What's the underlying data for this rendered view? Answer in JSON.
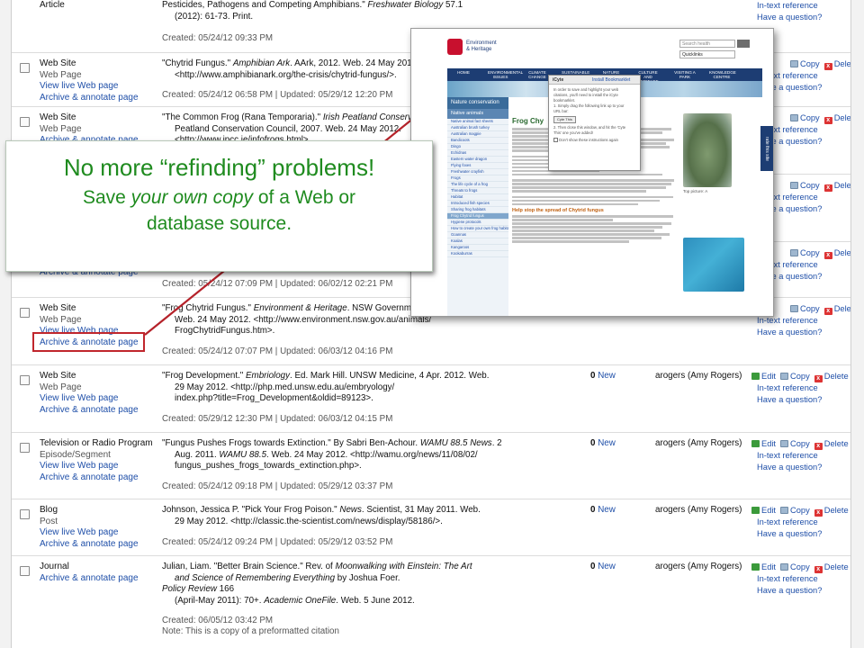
{
  "actions": {
    "edit": "Edit",
    "copy": "Copy",
    "delete": "Delete",
    "intext": "In-text reference",
    "question": "Have a question?"
  },
  "row0": {
    "type": "Article",
    "cite1": "Pesticides, Pathogens and Competing Amphibians.\" ",
    "cite1_it": "Freshwater Biology",
    "cite1_end": " 57.1",
    "cite2": "(2012): 61-73. Print.",
    "created": "Created: 05/24/12 09:33 PM"
  },
  "row1": {
    "type": "Web Site",
    "sub": "Web Page",
    "link1": "View live Web page",
    "link2": "Archive & annotate page",
    "cite1a": "\"Chytrid Fungus.\" ",
    "cite1_it": "Amphibian Ark",
    "cite1b": ". AArk, 2012. Web. 24 May 2012",
    "cite2": "<http://www.amphibianark.org/the-crisis/chytrid-fungus/>.",
    "created": "Created: 05/24/12 06:58 PM | Updated: 05/29/12 12:20 PM"
  },
  "row2": {
    "type": "Web Site",
    "sub": "Web Page",
    "link2": "Archive & annotate page",
    "cite1a": "\"The Common Frog (Rana Temporaria).\" ",
    "cite1_it": "Irish Peatland Conserv",
    "cite2": "Peatland Conservation Council, 2007. Web. 24 May 2012.",
    "cite3": "<http://www.ipcc.ie/infofrogs.html>."
  },
  "row3": {
    "link2": "Archive & annotate page",
    "created": "Created: 05/24/12 07:09 PM | Updated: 06/02/12 02:21 PM"
  },
  "row4": {
    "type": "Web Site",
    "sub": "Web Page",
    "link1": "View live Web page",
    "link2": "Archive & annotate page",
    "cite1a": "\"Frog Chytrid Fungus.\" ",
    "cite1_it": "Environment & Heritage",
    "cite1b": ". NSW Governme",
    "cite2": "Web. 24 May 2012. <http://www.environment.nsw.gov.au/animals/",
    "cite3": "FrogChytridFungus.htm>.",
    "created": "Created: 05/24/12 07:07 PM | Updated: 06/03/12 04:16 PM"
  },
  "row5": {
    "type": "Web Site",
    "sub": "Web Page",
    "link1": "View live Web page",
    "link2": "Archive & annotate page",
    "cite1a": "\"Frog Development.\" ",
    "cite1_it": "Embriology",
    "cite1b": ". Ed. Mark Hill. UNSW Medicine, 4 Apr. 2012. Web.",
    "cite2": "29 May 2012. <http://php.med.unsw.edu.au/embryology/",
    "cite3": "index.php?title=Frog_Development&oldid=89123>.",
    "created": "Created: 05/29/12 12:30 PM | Updated: 06/03/12 04:15 PM",
    "count": "0",
    "new": "New",
    "owner": "arogers (Amy Rogers)"
  },
  "row6": {
    "type": "Television or Radio Program",
    "sub": "Episode/Segment",
    "link1": "View live Web page",
    "link2": "Archive & annotate page",
    "cite1a": "\"Fungus Pushes Frogs towards Extinction.\" By Sabri Ben-Achour. ",
    "cite1_it": "WAMU 88.5 News",
    "cite1b": ". 2",
    "cite2a": "Aug. 2011. ",
    "cite2_it": "WAMU 88.5",
    "cite2b": ". Web. 24 May 2012. <http://wamu.org/news/11/08/02/",
    "cite3": "fungus_pushes_frogs_towards_extinction.php>.",
    "created": "Created: 05/24/12 09:18 PM | Updated: 05/29/12 03:37 PM",
    "count": "0",
    "new": "New",
    "owner": "arogers (Amy Rogers)"
  },
  "row7": {
    "type": "Blog",
    "sub": "Post",
    "link1": "View live Web page",
    "link2": "Archive & annotate page",
    "cite1a": "Johnson, Jessica P. \"Pick Your Frog Poison.\" ",
    "cite1_it": "News",
    "cite1b": ". Scientist, 31 May 2011. Web.",
    "cite2": "29 May 2012. <http://classic.the-scientist.com/news/display/58186/>.",
    "created": "Created: 05/24/12 09:24 PM | Updated: 05/29/12 03:52 PM",
    "count": "0",
    "new": "New",
    "owner": "arogers (Amy Rogers)"
  },
  "row8": {
    "type": "Journal",
    "link2": "Archive & annotate page",
    "cite1a": "Julian, Liam. \"Better Brain Science.\" Rev. of ",
    "cite1_it": "Moonwalking with Einstein: The Art",
    "cite2_it": "and Science of Remembering Everything",
    "cite2b": " by Joshua Foer.",
    "cite3_it": "Policy Review",
    "cite3b": " 166",
    "cite4a": "(April-May 2011): 70+. ",
    "cite4_it": "Academic OneFile",
    "cite4b": ". Web. 5 June 2012.",
    "created": "Created: 06/05/12 03:42 PM",
    "note": "Note: This is a copy of a preformatted citation",
    "count": "0",
    "new": "New",
    "owner": "arogers (Amy Rogers)"
  },
  "callout": {
    "line1": "No more “refinding” problems!",
    "line2a": "Save ",
    "line2_it": "your own copy",
    "line2b": " of a Web or",
    "line3": "database source."
  },
  "shot": {
    "org1": "Environment",
    "org2": "& Heritage",
    "search_placeholder": "Search health",
    "quicklinks": "Quicklinks",
    "nav": [
      "HOME",
      "ENVIRONMENTAL ISSUES",
      "CLIMATE CHANGE",
      "SUSTAINABLE LIVING",
      "NATURE",
      "CULTURE AND HERITAGE",
      "VISITING A PARK",
      "KNOWLEDGE CENTRE"
    ],
    "side_title": "Nature conservation",
    "side_sub": "Native animals",
    "side_items": [
      "Native animal fact sheets",
      "Australian brush turkey",
      "Australian magpie",
      "Bandicoots",
      "Dingo",
      "Echidnas",
      "Eastern water dragon",
      "Flying foxes",
      "Freshwater crayfish",
      "Frogs",
      "The life cycle of a frog",
      "Threats to frogs",
      "Habitat",
      "Introduced fish species",
      "Sharing frog habitats",
      "Frog Chytrid fungus",
      "Hygiene protocols",
      "How to create your own frog habitat",
      "Goannas",
      "Koalas",
      "Kangaroos",
      "Kookaburras"
    ],
    "main_title": "Frog Chy",
    "help_title": "Help stop the spread of Chytrid fungus",
    "caption": "Top picture: A",
    "sidetab": "rate this site",
    "popup_title": "Install Bookmarklet",
    "popup_logo": "iCyte",
    "popup_lines": [
      "In order to save and highlight your web",
      "citations, you'll need to install the iCyte",
      "bookmarklet.",
      "1. Simply drag the following link up to your",
      "URL bar:"
    ],
    "popup_btn": "Cyte This",
    "popup_lines2": [
      "2. Then close this window, and hit the 'Cyte",
      "This' one you've added!"
    ],
    "popup_check": "Don't show these instructions again"
  },
  "colors": {
    "callout_text": "#1f8b1f",
    "highlight_border": "#c0262c",
    "link": "#1f4fa8"
  }
}
